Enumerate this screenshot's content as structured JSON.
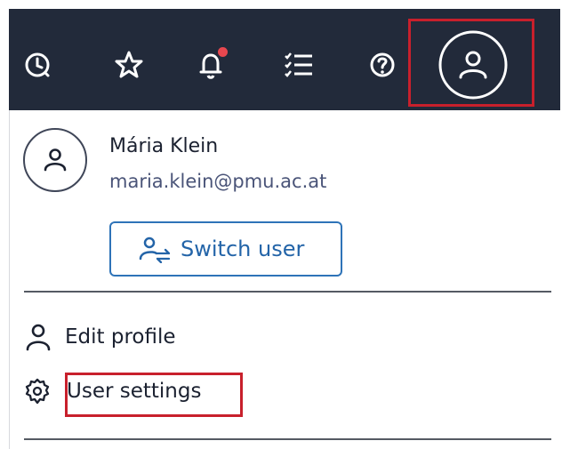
{
  "topbar": {
    "icons": [
      "history-icon",
      "star-icon",
      "bell-icon",
      "checklist-icon",
      "help-icon",
      "avatar-icon"
    ],
    "has_notification": true
  },
  "profile_menu": {
    "user_name": "Mária Klein",
    "user_email": "maria.klein@pmu.ac.at",
    "switch_user_label": "Switch user",
    "edit_profile_label": "Edit profile",
    "user_settings_label": "User settings"
  },
  "colors": {
    "topbar_bg": "#222a3a",
    "accent_blue": "#2e73b8",
    "highlight_red": "#c8202c",
    "notification_red": "#e8474f"
  }
}
